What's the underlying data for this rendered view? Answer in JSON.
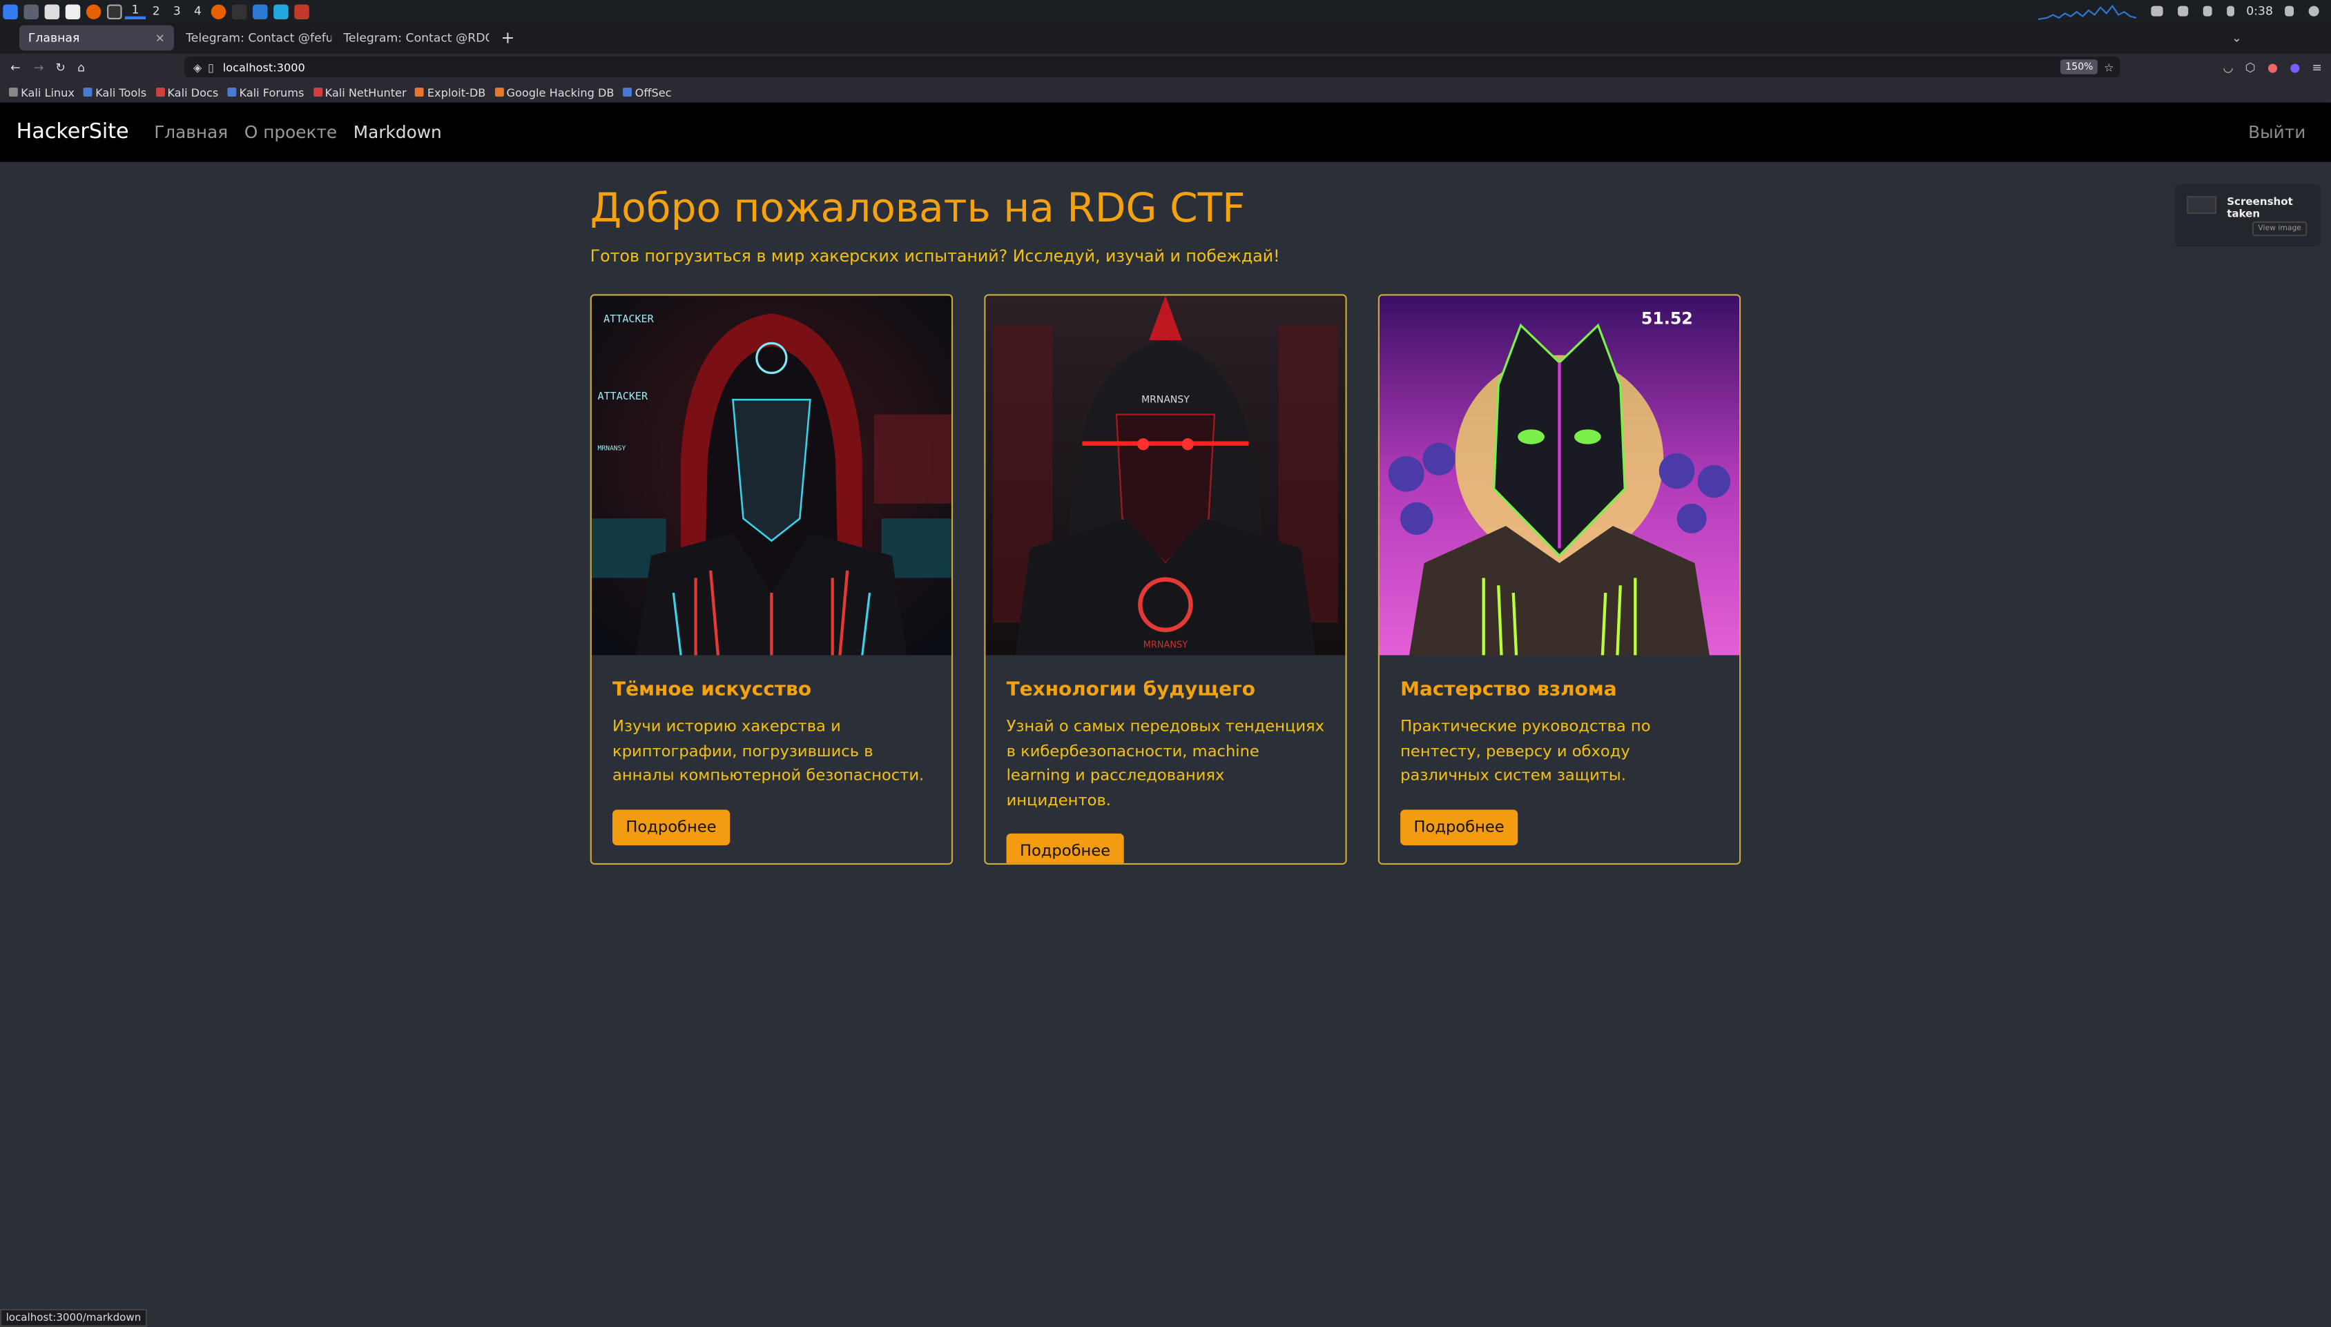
{
  "system_bar": {
    "workspaces": [
      "1",
      "2",
      "3",
      "4"
    ],
    "clock": "0:38"
  },
  "browser": {
    "tabs": [
      {
        "label": "Главная",
        "close": "×"
      },
      {
        "label": "Telegram: Contact @fefu",
        "close": "×"
      },
      {
        "label": "Telegram: Contact @RDG",
        "close": "×"
      }
    ],
    "new_tab": "+",
    "url": "localhost:3000",
    "zoom": "150%",
    "bookmarks": [
      "Kali Linux",
      "Kali Tools",
      "Kali Docs",
      "Kali Forums",
      "Kali NetHunter",
      "Exploit-DB",
      "Google Hacking DB",
      "OffSec"
    ],
    "status_url": "localhost:3000/markdown"
  },
  "site": {
    "brand": "HackerSite",
    "nav": [
      "Главная",
      "О проекте",
      "Markdown"
    ],
    "logout": "Выйти",
    "title": "Добро пожаловать на RDG CTF",
    "subtitle": "Готов погрузиться в мир хакерских испытаний? Исследуй, изучай и побеждай!",
    "cards": [
      {
        "title": "Тёмное искусство",
        "text": "Изучи историю хакерства и криптографии, погрузившись в анналы компьютерной безопасности.",
        "button": "Подробнее",
        "img_text_1": "ATTACKER",
        "img_text_2": "ATTACKER",
        "img_text_3": "MRNANSY"
      },
      {
        "title": "Технологии будущего",
        "text": "Узнай о самых передовых тенденциях в кибербезопасности, machine learning и расследованиях инцидентов.",
        "button": "Подробнее",
        "img_text_1": "MRNANSY",
        "img_text_2": "MRNANSY"
      },
      {
        "title": "Мастерство взлома",
        "text": "Практические руководства по пентесту, реверсу и обходу различных систем защиты.",
        "button": "Подробнее",
        "img_text_1": "51.52"
      }
    ]
  },
  "toast": {
    "title": "Screenshot taken",
    "action": "View image"
  }
}
